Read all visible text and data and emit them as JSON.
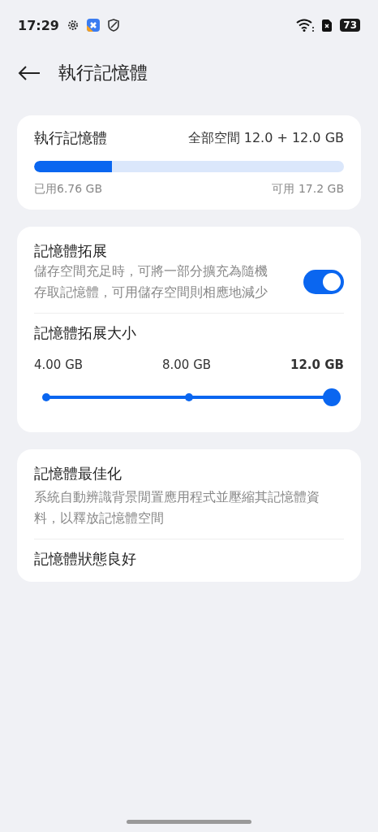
{
  "status_bar": {
    "time": "17:29",
    "battery": "73"
  },
  "header": {
    "title": "執行記憶體"
  },
  "memory": {
    "title": "執行記憶體",
    "total": "全部空間 12.0 + 12.0 GB",
    "level": 0.25,
    "used": "已用6.76 GB",
    "available": "可用 17.2 GB"
  },
  "extension": {
    "title": "記憶體拓展",
    "description": "儲存空間充足時，可將一部分擴充為隨機存取記憶體，可用儲存空間則相應地減少",
    "on": true,
    "size_title": "記憶體拓展大小",
    "stops": [
      {
        "label": "4.00 GB",
        "selected": false
      },
      {
        "label": "8.00 GB",
        "selected": false
      },
      {
        "label": "12.0 GB",
        "selected": true
      }
    ]
  },
  "optimization": {
    "title": "記憶體最佳化",
    "description": "系統自動辨識背景閒置應用程式並壓縮其記憶體資料，以釋放記憶體空間",
    "status": "記憶體狀態良好"
  }
}
